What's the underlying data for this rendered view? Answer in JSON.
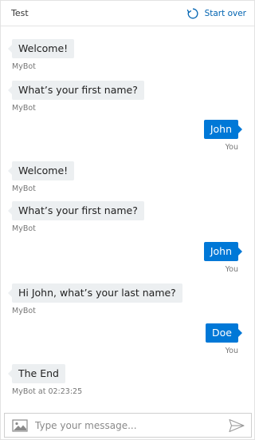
{
  "header": {
    "title": "Test",
    "start_over_label": "Start over"
  },
  "messages": [
    {
      "from": "bot",
      "text": "Welcome!",
      "meta": "MyBot"
    },
    {
      "from": "bot",
      "text": "What’s your first name?",
      "meta": "MyBot"
    },
    {
      "from": "user",
      "text": "John",
      "meta": "You"
    },
    {
      "from": "bot",
      "text": "Welcome!",
      "meta": "MyBot"
    },
    {
      "from": "bot",
      "text": "What’s your first name?",
      "meta": "MyBot"
    },
    {
      "from": "user",
      "text": "John",
      "meta": "You"
    },
    {
      "from": "bot",
      "text": "Hi John, what’s your last name?",
      "meta": "MyBot"
    },
    {
      "from": "user",
      "text": "Doe",
      "meta": "You"
    },
    {
      "from": "bot",
      "text": "The End",
      "meta": "MyBot at 02:23:25"
    }
  ],
  "composer": {
    "placeholder": "Type your message...",
    "value": ""
  },
  "icons": {
    "start_over": "refresh-icon",
    "attach": "image-icon",
    "send": "send-icon"
  },
  "colors": {
    "user_bubble": "#0078d7",
    "bot_bubble": "#eceff1",
    "accent": "#0063b1"
  }
}
